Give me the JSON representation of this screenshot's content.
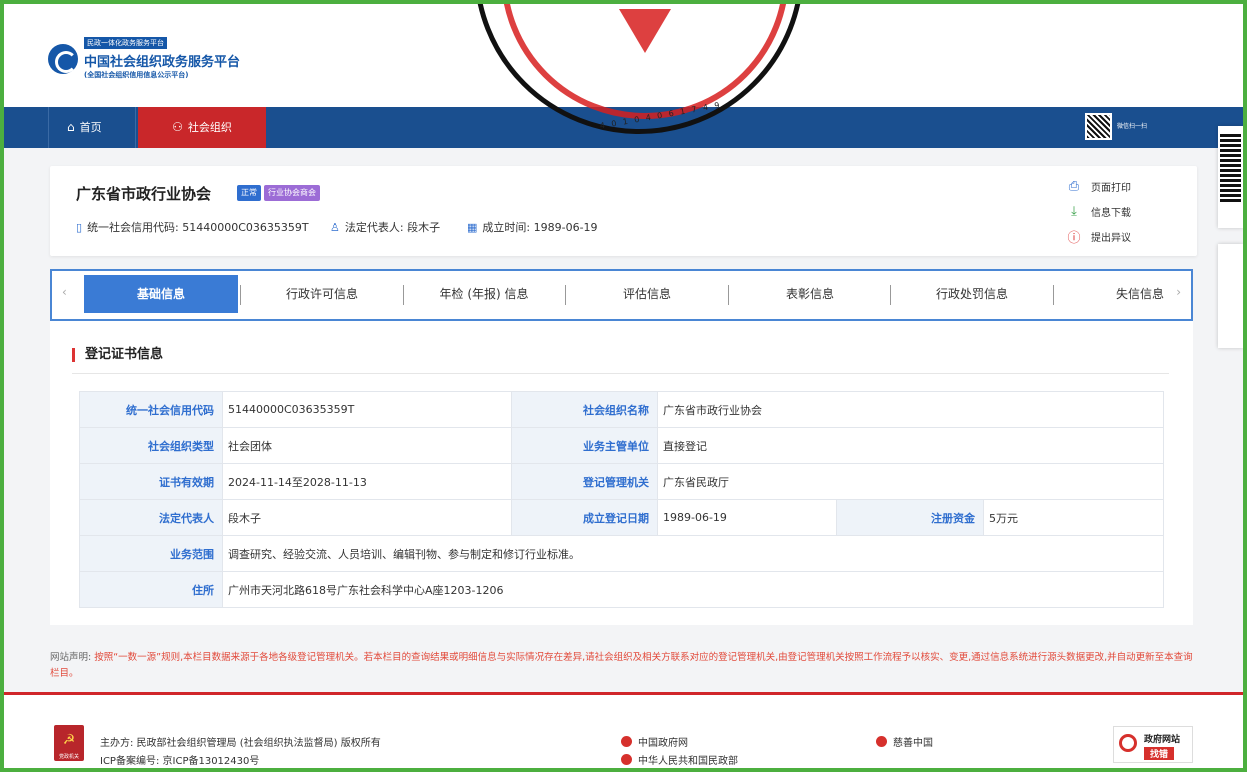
{
  "colors": {
    "brand_blue": "#1a4f8f",
    "accent_red": "#c9272a",
    "tab_active": "#3a7bd5",
    "frame_green": "#4caf3f"
  },
  "site": {
    "tag": "民政一体化政务服务平台",
    "title": "中国社会组织政务服务平台",
    "subtitle": "(全国社会组织信用信息公示平台)",
    "seal_digits": "4 0 1 0 4 0 6 1 7 4 9"
  },
  "nav": {
    "home": "首页",
    "org": "社会组织",
    "qr_label": "微信扫一扫"
  },
  "org": {
    "name": "广东省市政行业协会",
    "badge_status": "正常",
    "badge_type": "行业协会商会",
    "credit_code": "统一社会信用代码: 51440000C03635359T",
    "legal_rep": "法定代表人: 段木子",
    "founded": "成立时间: 1989-06-19"
  },
  "actions": {
    "print": "页面打印",
    "download": "信息下载",
    "objection": "提出异议"
  },
  "tabs": [
    "基础信息",
    "行政许可信息",
    "年检 (年报) 信息",
    "评估信息",
    "表彰信息",
    "行政处罚信息",
    "失信信息"
  ],
  "section": {
    "title": "登记证书信息"
  },
  "info": {
    "credit_code_label": "统一社会信用代码",
    "credit_code": "51440000C03635359T",
    "org_name_label": "社会组织名称",
    "org_name": "广东省市政行业协会",
    "org_type_label": "社会组织类型",
    "org_type": "社会团体",
    "supervisor_label": "业务主管单位",
    "supervisor": "直接登记",
    "validity_label": "证书有效期",
    "validity": "2024-11-14至2028-11-13",
    "authority_label": "登记管理机关",
    "authority": "广东省民政厅",
    "rep_label": "法定代表人",
    "rep": "段木子",
    "reg_date_label": "成立登记日期",
    "reg_date": "1989-06-19",
    "capital_label": "注册资金",
    "capital": "5万元",
    "scope_label": "业务范围",
    "scope": "调查研究、经验交流、人员培训、编辑刊物、参与制定和修订行业标准。",
    "address_label": "住所",
    "address": "广州市天河北路618号广东社会科学中心A座1203-1206"
  },
  "disclaimer": {
    "label": "网站声明:",
    "text": "按照“一数一源”规则,本栏目数据来源于各地各级登记管理机关。若本栏目的查询结果或明细信息与实际情况存在差异,请社会组织及相关方联系对应的登记管理机关,由登记管理机关按照工作流程予以核实、变更,通过信息系统进行源头数据更改,并自动更新至本查询栏目。"
  },
  "footer": {
    "party_label": "党政机关",
    "host": "主办方: 民政部社会组织管理局 (社会组织执法监督局) 版权所有",
    "icp": "ICP备案编号: 京ICP备13012430号",
    "gov": "中国政府网",
    "ministry": "中华人民共和国民政部",
    "charity": "慈善中国",
    "find_error_1": "政府网站",
    "find_error_2": "找错"
  }
}
